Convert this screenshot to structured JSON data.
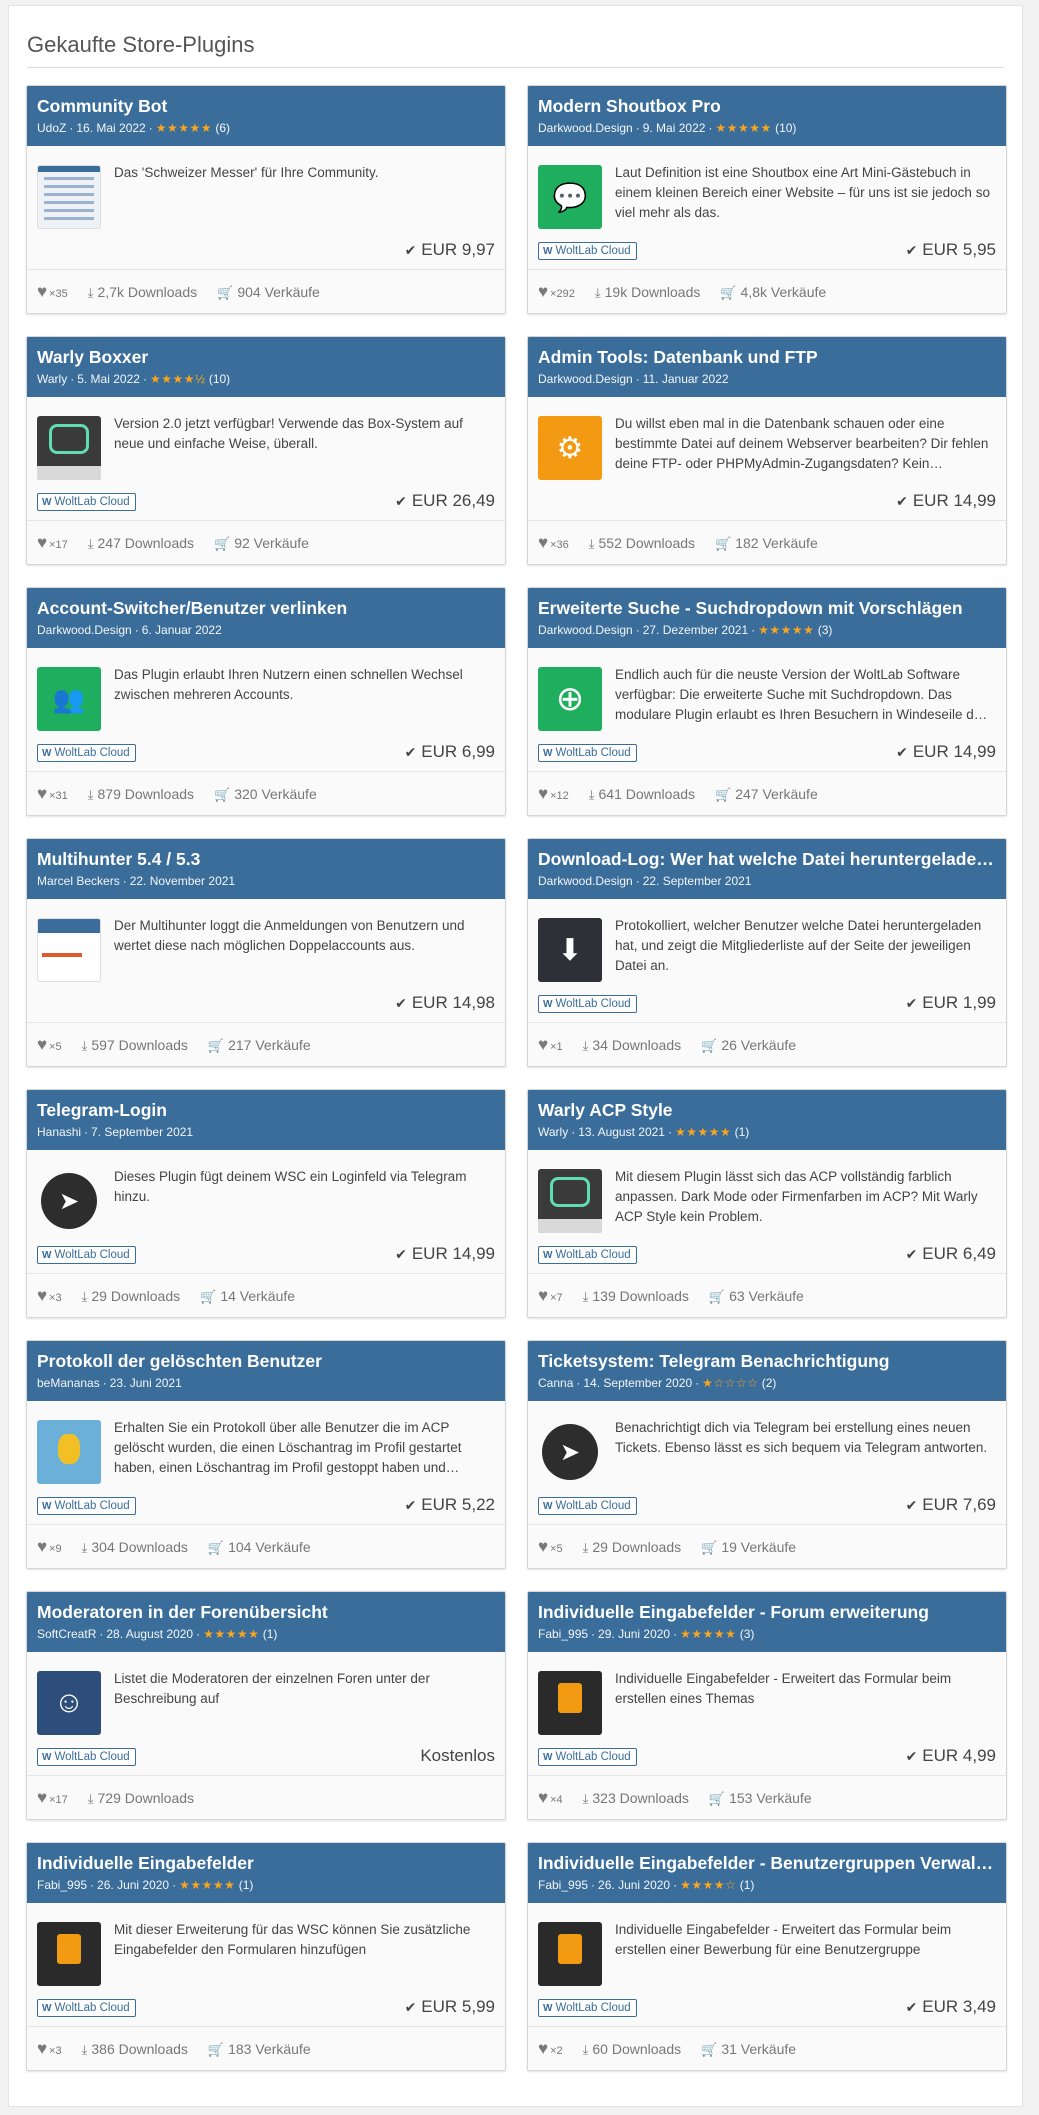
{
  "page_title": "Gekaufte Store-Plugins",
  "cloud_label": "WoltLab Cloud",
  "currency_check": "✔",
  "plugins": [
    {
      "title": "Community Bot",
      "author": "UdoZ",
      "date": "16. Mai 2022",
      "stars": "★★★★★",
      "rating_count": "(6)",
      "thumb": "screen",
      "description": "Das 'Schweizer Messer' für Ihre Community.",
      "cloud": false,
      "price": "EUR 9,97",
      "likes": "×35",
      "downloads": "2,7k Downloads",
      "sales": "904 Verkäufe"
    },
    {
      "title": "Modern Shoutbox Pro",
      "author": "Darkwood.Design",
      "date": "9. Mai 2022",
      "stars": "★★★★★",
      "rating_count": "(10)",
      "thumb": "green-chat",
      "description": "Laut Definition ist eine Shoutbox eine Art Mini-Gästebuch in einem kleinen Bereich einer Website – für uns ist sie jedoch so viel mehr als das.",
      "cloud": true,
      "price": "EUR 5,95",
      "likes": "×292",
      "downloads": "19k Downloads",
      "sales": "4,8k Verkäufe"
    },
    {
      "title": "Warly Boxxer",
      "author": "Warly",
      "date": "5. Mai 2022",
      "stars": "★★★★½",
      "rating_count": "(10)",
      "thumb": "warly-boxxer",
      "description": "Version 2.0 jetzt verfügbar! Verwende das Box-System auf neue und einfache Weise, überall.",
      "cloud": true,
      "price": "EUR 26,49",
      "likes": "×17",
      "downloads": "247 Downloads",
      "sales": "92 Verkäufe"
    },
    {
      "title": "Admin Tools: Datenbank und FTP",
      "author": "Darkwood.Design",
      "date": "11. Januar 2022",
      "stars": "",
      "rating_count": "",
      "thumb": "orange-user",
      "description": "Du willst eben mal in die Datenbank schauen oder eine bestimmte Datei auf deinem Webserver bearbeiten? Dir fehlen deine FTP- oder PHPMyAdmin-Zugangsdaten? Kein Problem…",
      "cloud": false,
      "price": "EUR 14,99",
      "likes": "×36",
      "downloads": "552 Downloads",
      "sales": "182 Verkäufe"
    },
    {
      "title": "Account-Switcher/Benutzer verlinken",
      "author": "Darkwood.Design",
      "date": "6. Januar 2022",
      "stars": "",
      "rating_count": "",
      "thumb": "green-users",
      "description": "Das Plugin erlaubt Ihren Nutzern einen schnellen Wechsel zwischen mehreren Accounts.",
      "cloud": true,
      "price": "EUR 6,99",
      "likes": "×31",
      "downloads": "879 Downloads",
      "sales": "320 Verkäufe"
    },
    {
      "title": "Erweiterte Suche - Suchdropdown mit Vorschlägen",
      "author": "Darkwood.Design",
      "date": "27. Dezember 2021",
      "stars": "★★★★★",
      "rating_count": "(3)",
      "thumb": "green-search",
      "description": "Endlich auch für die neuste Version der WoltLab Software verfügbar: Die erweiterte Suche mit Suchdropdown. Das modulare Plugin erlaubt es Ihren Besuchern in Windeseile d…",
      "cloud": true,
      "price": "EUR 14,99",
      "likes": "×12",
      "downloads": "641 Downloads",
      "sales": "247 Verkäufe"
    },
    {
      "title": "Multihunter 5.4 / 5.3",
      "author": "Marcel Beckers",
      "date": "22. November 2021",
      "stars": "",
      "rating_count": "",
      "thumb": "multihunter",
      "description": "Der Multihunter loggt die Anmeldungen von Benutzern und wertet diese nach möglichen Doppelaccounts aus.",
      "cloud": false,
      "price": "EUR 14,98",
      "likes": "×5",
      "downloads": "597 Downloads",
      "sales": "217 Verkäufe"
    },
    {
      "title": "Download-Log: Wer hat welche Datei heruntergeladen?",
      "author": "Darkwood.Design",
      "date": "22. September 2021",
      "stars": "",
      "rating_count": "",
      "thumb": "dark-download",
      "description": "Protokolliert, welcher Benutzer welche Datei heruntergeladen hat, und zeigt die Mitgliederliste auf der Seite der jeweiligen Datei an.",
      "cloud": true,
      "price": "EUR 1,99",
      "likes": "×1",
      "downloads": "34 Downloads",
      "sales": "26 Verkäufe"
    },
    {
      "title": "Telegram-Login",
      "author": "Hanashi",
      "date": "7. September 2021",
      "stars": "",
      "rating_count": "",
      "thumb": "telegram",
      "description": "Dieses Plugin fügt deinem WSC ein Loginfeld via Telegram hinzu.",
      "cloud": true,
      "price": "EUR 14,99",
      "likes": "×3",
      "downloads": "29 Downloads",
      "sales": "14 Verkäufe"
    },
    {
      "title": "Warly ACP Style",
      "author": "Warly",
      "date": "13. August 2021",
      "stars": "★★★★★",
      "rating_count": "(1)",
      "thumb": "warly-acp",
      "description": "Mit diesem Plugin lässt sich das ACP vollständig farblich anpassen. Dark Mode oder Firmenfarben im ACP? Mit Warly ACP Style kein Problem.",
      "cloud": true,
      "price": "EUR 6,49",
      "likes": "×7",
      "downloads": "139 Downloads",
      "sales": "63 Verkäufe"
    },
    {
      "title": "Protokoll der gelöschten Benutzer",
      "author": "beMananas",
      "date": "23. Juni 2021",
      "stars": "",
      "rating_count": "",
      "thumb": "bemananas",
      "description": "Erhalten Sie ein Protokoll über alle Benutzer die im ACP gelöscht wurden, die einen Löschantrag im Profil gestartet haben, einen Löschantrag im Profil gestoppt haben und…",
      "cloud": true,
      "price": "EUR 5,22",
      "likes": "×9",
      "downloads": "304 Downloads",
      "sales": "104 Verkäufe"
    },
    {
      "title": "Ticketsystem: Telegram Benachrichtigung",
      "author": "Canna",
      "date": "14. September 2020",
      "stars": "★☆☆☆☆",
      "rating_count": "(2)",
      "thumb": "telegram",
      "description": "Benachrichtigt dich via Telegram bei erstellung eines neuen Tickets. Ebenso lässt es sich bequem via Telegram antworten.",
      "cloud": true,
      "price": "EUR 7,69",
      "likes": "×5",
      "downloads": "29 Downloads",
      "sales": "19 Verkäufe"
    },
    {
      "title": "Moderatoren in der Forenübersicht",
      "author": "SoftCreatR",
      "date": "28. August 2020",
      "stars": "★★★★★",
      "rating_count": "(1)",
      "thumb": "navy-mod",
      "description": "Listet die Moderatoren der einzelnen Foren unter der Beschreibung auf",
      "cloud": true,
      "price": "Kostenlos",
      "free": true,
      "likes": "×17",
      "downloads": "729 Downloads",
      "sales": ""
    },
    {
      "title": "Individuelle Eingabefelder - Forum erweiterung",
      "author": "Fabi_995",
      "date": "29. Juni 2020",
      "stars": "★★★★★",
      "rating_count": "(3)",
      "thumb": "clip",
      "description": "Individuelle Eingabefelder - Erweitert das Formular beim erstellen eines Themas",
      "cloud": true,
      "price": "EUR 4,99",
      "likes": "×4",
      "downloads": "323 Downloads",
      "sales": "153 Verkäufe"
    },
    {
      "title": "Individuelle Eingabefelder",
      "author": "Fabi_995",
      "date": "26. Juni 2020",
      "stars": "★★★★★",
      "rating_count": "(1)",
      "thumb": "clip",
      "description": "Mit dieser Erweiterung für das WSC können Sie zusätzliche Eingabefelder den Formularen hinzufügen",
      "cloud": true,
      "price": "EUR 5,99",
      "likes": "×3",
      "downloads": "386 Downloads",
      "sales": "183 Verkäufe"
    },
    {
      "title": "Individuelle Eingabefelder - Benutzergruppen Verwaltung",
      "author": "Fabi_995",
      "date": "26. Juni 2020",
      "stars": "★★★★☆",
      "rating_count": "(1)",
      "thumb": "clip",
      "description": "Individuelle Eingabefelder - Erweitert das Formular beim erstellen einer Bewerbung für eine Benutzergruppe",
      "cloud": true,
      "price": "EUR 3,49",
      "likes": "×2",
      "downloads": "60 Downloads",
      "sales": "31 Verkäufe"
    }
  ]
}
